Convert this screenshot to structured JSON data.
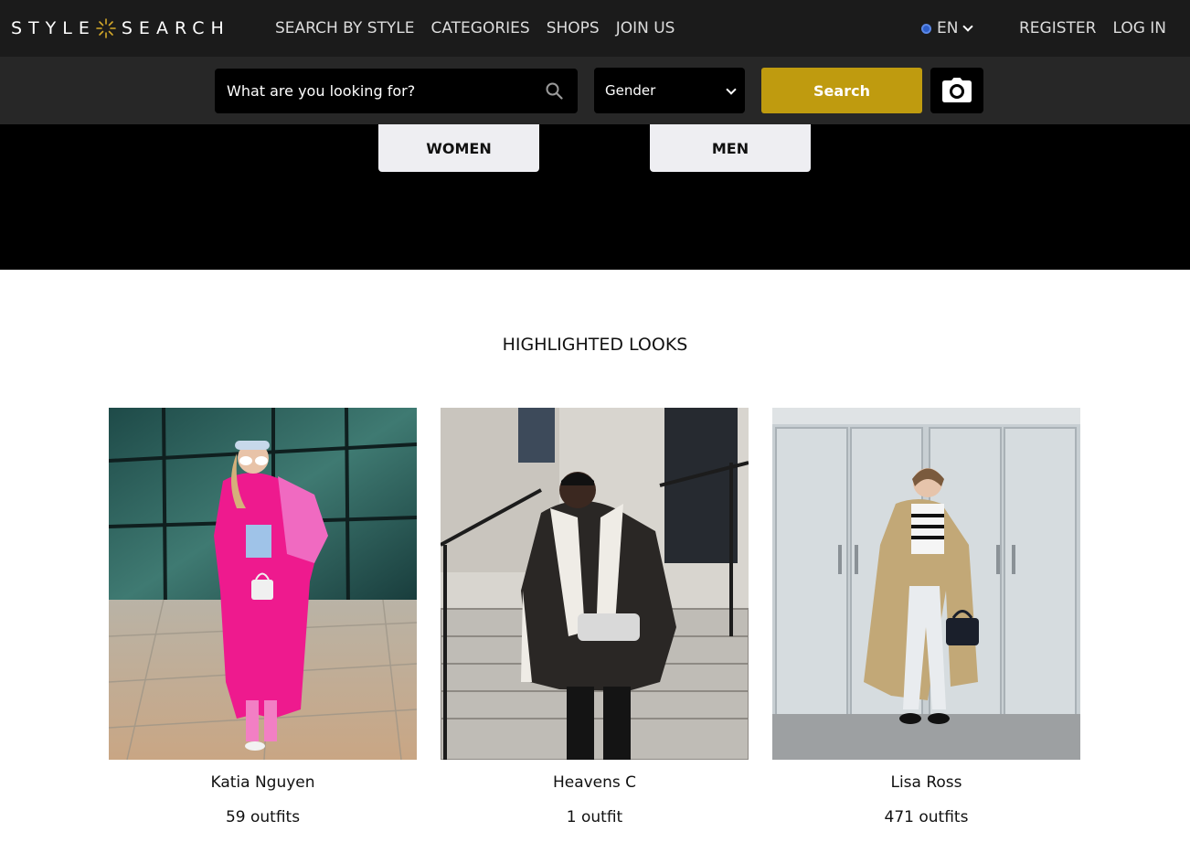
{
  "header": {
    "logo_left": "STYLE",
    "logo_right": "SEARCH",
    "nav": [
      "SEARCH BY STYLE",
      "CATEGORIES",
      "SHOPS",
      "JOIN US"
    ],
    "language": "EN",
    "register": "REGISTER",
    "login": "LOG IN"
  },
  "search": {
    "placeholder": "What are you looking for?",
    "gender_selected": "Gender",
    "button": "Search"
  },
  "hero": {
    "women": "WOMEN",
    "men": "MEN"
  },
  "highlighted": {
    "title": "HIGHLIGHTED LOOKS",
    "looks": [
      {
        "name": "Katia Nguyen",
        "outfits": "59 outfits"
      },
      {
        "name": "Heavens C",
        "outfits": "1 outfit"
      },
      {
        "name": "Lisa Ross",
        "outfits": "471 outfits"
      }
    ]
  },
  "colors": {
    "nav_bg": "#1b1b1b",
    "searchbar_bg": "#272727",
    "accent": "#bf9b0f",
    "hero_bg": "#000000",
    "gender_button_bg": "#eeeef2"
  }
}
